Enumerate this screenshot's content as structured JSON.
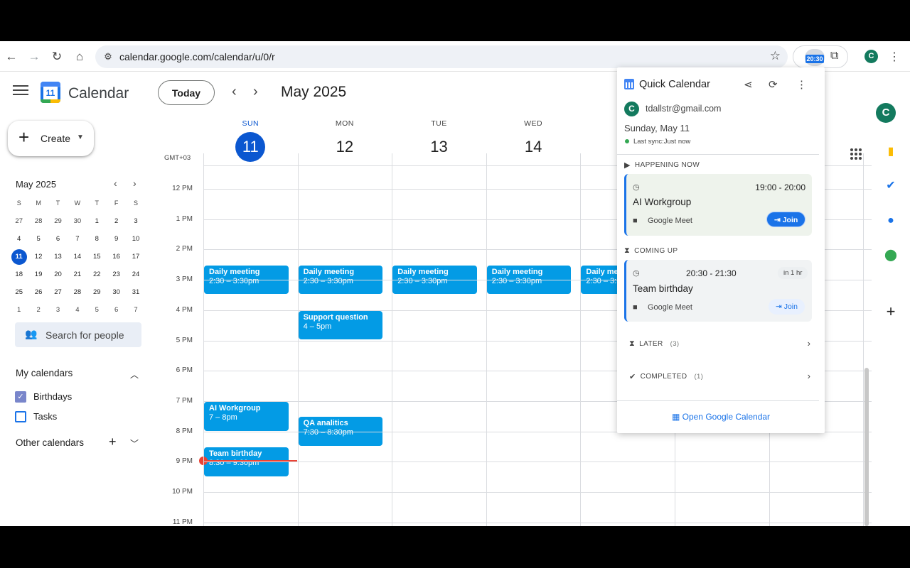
{
  "browser": {
    "url": "calendar.google.com/calendar/u/0/r",
    "extension_badge": "20:30",
    "profile_initial": "C"
  },
  "header": {
    "app_name": "Calendar",
    "logo_day": "11",
    "today_button": "Today",
    "period": "May 2025",
    "account_initial": "C"
  },
  "sidebar": {
    "create_label": "Create",
    "mini_calendar": {
      "title": "May 2025",
      "weekday_headers": [
        "S",
        "M",
        "T",
        "W",
        "T",
        "F",
        "S"
      ],
      "weeks": [
        [
          "27",
          "28",
          "29",
          "30",
          "1",
          "2",
          "3"
        ],
        [
          "4",
          "5",
          "6",
          "7",
          "8",
          "9",
          "10"
        ],
        [
          "11",
          "12",
          "13",
          "14",
          "15",
          "16",
          "17"
        ],
        [
          "18",
          "19",
          "20",
          "21",
          "22",
          "23",
          "24"
        ],
        [
          "25",
          "26",
          "27",
          "28",
          "29",
          "30",
          "31"
        ],
        [
          "1",
          "2",
          "3",
          "4",
          "5",
          "6",
          "7"
        ]
      ],
      "today": "11"
    },
    "search_people_placeholder": "Search for people",
    "my_calendars_title": "My calendars",
    "my_calendars": [
      {
        "label": "Birthdays",
        "checked": true
      },
      {
        "label": "Tasks",
        "checked": false
      }
    ],
    "other_calendars_title": "Other calendars"
  },
  "grid": {
    "timezone": "GMT+03",
    "days": [
      {
        "name": "SUN",
        "date": "11",
        "current": true
      },
      {
        "name": "MON",
        "date": "12",
        "current": false
      },
      {
        "name": "TUE",
        "date": "13",
        "current": false
      },
      {
        "name": "WED",
        "date": "14",
        "current": false
      }
    ],
    "hour_labels": [
      "12 PM",
      "1 PM",
      "2 PM",
      "3 PM",
      "4 PM",
      "5 PM",
      "6 PM",
      "7 PM",
      "8 PM",
      "9 PM",
      "10 PM",
      "11 PM"
    ],
    "events": [
      {
        "title": "Daily meeting",
        "time": "2:30 – 3:30pm",
        "day": "SUN"
      },
      {
        "title": "Daily meeting",
        "time": "2:30 – 3:30pm",
        "day": "MON"
      },
      {
        "title": "Daily meeting",
        "time": "2:30 – 3:30pm",
        "day": "TUE"
      },
      {
        "title": "Daily meeting",
        "time": "2:30 – 3:30pm",
        "day": "WED"
      },
      {
        "title": "Daily meeting",
        "time": "2:30 – 3:30pm",
        "day": "THU"
      },
      {
        "title": "Support question",
        "time": "4 – 5pm",
        "day": "MON"
      },
      {
        "title": "AI Workgroup",
        "time": "7 – 8pm",
        "day": "SUN"
      },
      {
        "title": "QA analitics",
        "time": "7:30 – 8:30pm",
        "day": "MON"
      },
      {
        "title": "Team birthday",
        "time": "8:30 – 9:30pm",
        "day": "SUN"
      }
    ]
  },
  "popup": {
    "title": "Quick Calendar",
    "account_initial": "C",
    "email": "tdallstr@gmail.com",
    "date": "Sunday, May 11",
    "sync_status": "Last sync:Just now",
    "happening_now_title": "HAPPENING NOW",
    "happening_now": {
      "time": "19:00 - 20:00",
      "title": "AI Workgroup",
      "location": "Google Meet",
      "join": "Join"
    },
    "coming_up_title": "COMING UP",
    "coming_up": {
      "time": "20:30 - 21:30",
      "relative": "in 1 hr",
      "title": "Team birthday",
      "location": "Google Meet",
      "join": "Join"
    },
    "later_title": "LATER",
    "later_count": "(3)",
    "completed_title": "COMPLETED",
    "completed_count": "(1)",
    "open_link": "Open Google Calendar"
  },
  "colors": {
    "event_blue": "#039be5",
    "accent": "#0b57d0",
    "now_line": "#ea4335",
    "happening_bg": "#eef3ec",
    "coming_bg": "#f1f3f4"
  }
}
